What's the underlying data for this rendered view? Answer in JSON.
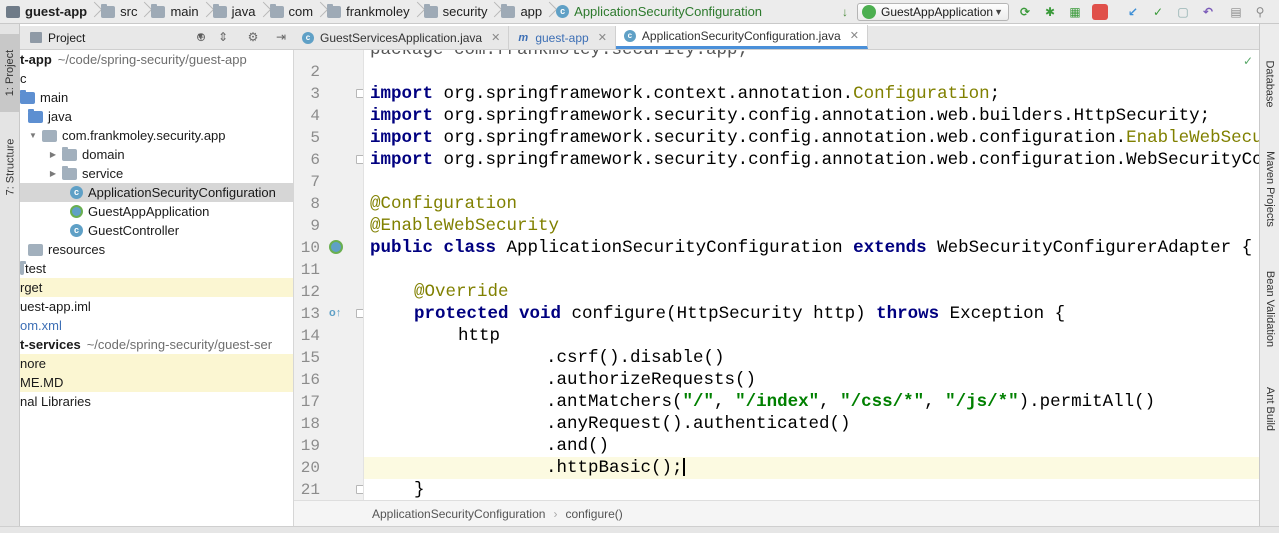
{
  "navbar": {
    "crumbs": [
      {
        "label": "guest-app",
        "icon": "module-icon",
        "bold": true
      },
      {
        "label": "src",
        "icon": "folder-icon"
      },
      {
        "label": "main",
        "icon": "folder-icon"
      },
      {
        "label": "java",
        "icon": "folder-icon"
      },
      {
        "label": "com",
        "icon": "folder-icon"
      },
      {
        "label": "frankmoley",
        "icon": "folder-icon"
      },
      {
        "label": "security",
        "icon": "folder-icon"
      },
      {
        "label": "app",
        "icon": "folder-icon"
      },
      {
        "label": "ApplicationSecurityConfiguration",
        "icon": "class-icon"
      }
    ],
    "run_config": "GuestAppApplication"
  },
  "left_strip": {
    "project_tab": "1: Project",
    "structure_tab": "7: Structure"
  },
  "right_strip": {
    "database_tab": "Database",
    "maven_tab": "Maven Projects",
    "bean_tab": "Bean Validation",
    "ant_tab": "Ant Build"
  },
  "project_panel": {
    "title": "Project",
    "rows": [
      {
        "label": "t-app",
        "muted": "~/code/spring-security/guest-app",
        "bold": true
      },
      {
        "label": "c"
      },
      {
        "label": "main"
      },
      {
        "label": "java"
      },
      {
        "label": "com.frankmoley.security.app"
      },
      {
        "label": "domain"
      },
      {
        "label": "service"
      },
      {
        "label": "ApplicationSecurityConfiguration"
      },
      {
        "label": "GuestAppApplication"
      },
      {
        "label": "GuestController"
      },
      {
        "label": "resources"
      },
      {
        "label": "test"
      },
      {
        "label": "rget"
      },
      {
        "label": "uest-app.iml"
      },
      {
        "label": "om.xml"
      },
      {
        "label": "t-services",
        "muted": "~/code/spring-security/guest-ser",
        "bold": true
      },
      {
        "label": "nore"
      },
      {
        "label": "ME.MD"
      },
      {
        "label": "nal Libraries"
      }
    ]
  },
  "editor_tabs": [
    {
      "label": "GuestServicesApplication.java"
    },
    {
      "label": "guest-app"
    },
    {
      "label": "ApplicationSecurityConfiguration.java"
    }
  ],
  "editor": {
    "line_numbers": [
      "2",
      "3",
      "4",
      "5",
      "6",
      "7",
      "8",
      "9",
      "10",
      "11",
      "12",
      "13",
      "14",
      "15",
      "16",
      "17",
      "18",
      "19",
      "20",
      "21"
    ],
    "top_partial_line": "package com.frankmoley.security.app;"
  },
  "code": {
    "l3": {
      "kw": "import",
      "pkg": " org.springframework.context.annotation.",
      "cls": "Configuration",
      "end": ";"
    },
    "l4": {
      "kw": "import",
      "rest": " org.springframework.security.config.annotation.web.builders.HttpSecurity;"
    },
    "l5": {
      "kw": "import",
      "pkg": " org.springframework.security.config.annotation.web.configuration.",
      "cls": "EnableWebSecurity;"
    },
    "l6": {
      "kw": "import",
      "rest": " org.springframework.security.config.annotation.web.configuration.WebSecurityConfigurerAdapter;"
    },
    "l8": {
      "ann": "@Configuration"
    },
    "l9": {
      "ann": "@EnableWebSecurity"
    },
    "l10": {
      "kw1": "public",
      "kw2": "class",
      "name": " ApplicationSecurityConfiguration ",
      "kw3": "extends",
      "rest": " WebSecurityConfigurerAdapter {"
    },
    "l12": {
      "ann": "@Override"
    },
    "l13": {
      "kw1": "protected",
      "kw2": "void",
      "sig": " configure(HttpSecurity http) ",
      "kw3": "throws",
      "rest": " Exception {"
    },
    "l14": {
      "text": "http"
    },
    "l15": {
      "text": ".csrf().disable()"
    },
    "l16": {
      "text": ".authorizeRequests()"
    },
    "l17": {
      "pre": ".antMatchers(",
      "s1": "\"/\"",
      "c1": ", ",
      "s2": "\"/index\"",
      "c2": ", ",
      "s3": "\"/css/*\"",
      "c3": ", ",
      "s4": "\"/js/*\"",
      "post": ").permitAll()"
    },
    "l18": {
      "text": ".anyRequest().authenticated()"
    },
    "l19": {
      "text": ".and()"
    },
    "l20": {
      "text": ".httpBasic();"
    },
    "l21": {
      "text": "}"
    }
  },
  "breadcrumb_bottom": {
    "cls": "ApplicationSecurityConfiguration",
    "method": "configure()"
  },
  "colors": {
    "keyword": "#000080",
    "annotation": "#808000",
    "string": "#008000",
    "current_line": "#fcfae1",
    "selection": "#d6d6d6"
  }
}
